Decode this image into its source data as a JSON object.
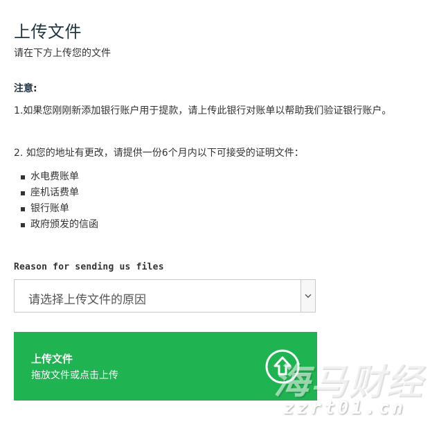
{
  "page": {
    "title": "上传文件",
    "intro": "请在下方上传您的文件",
    "note_label": "注意:",
    "note_1": "1.如果您刚刚新添加银行账户用于提款，请上传此银行对账单以帮助我们验证银行账户。",
    "note_2": "2. 如您的地址有更改，请提供一份6个月内以下可接受的证明文件：",
    "documents": [
      "水电费账单",
      "座机话费单",
      "银行账单",
      "政府颁发的信函"
    ]
  },
  "form": {
    "reason_label": "Reason for sending us files",
    "reason_select": {
      "selected": "请选择上传文件的原因"
    },
    "upload": {
      "title": "上传文件",
      "subtitle": "拖放文件或点击上传",
      "icon": "upload-arrow-icon"
    }
  },
  "watermark": {
    "main": "海马财经",
    "url": "zzrt01.cn"
  },
  "colors": {
    "upload_green": "#20b352",
    "title_color": "#1f3440",
    "select_border": "#c9c9c9"
  }
}
